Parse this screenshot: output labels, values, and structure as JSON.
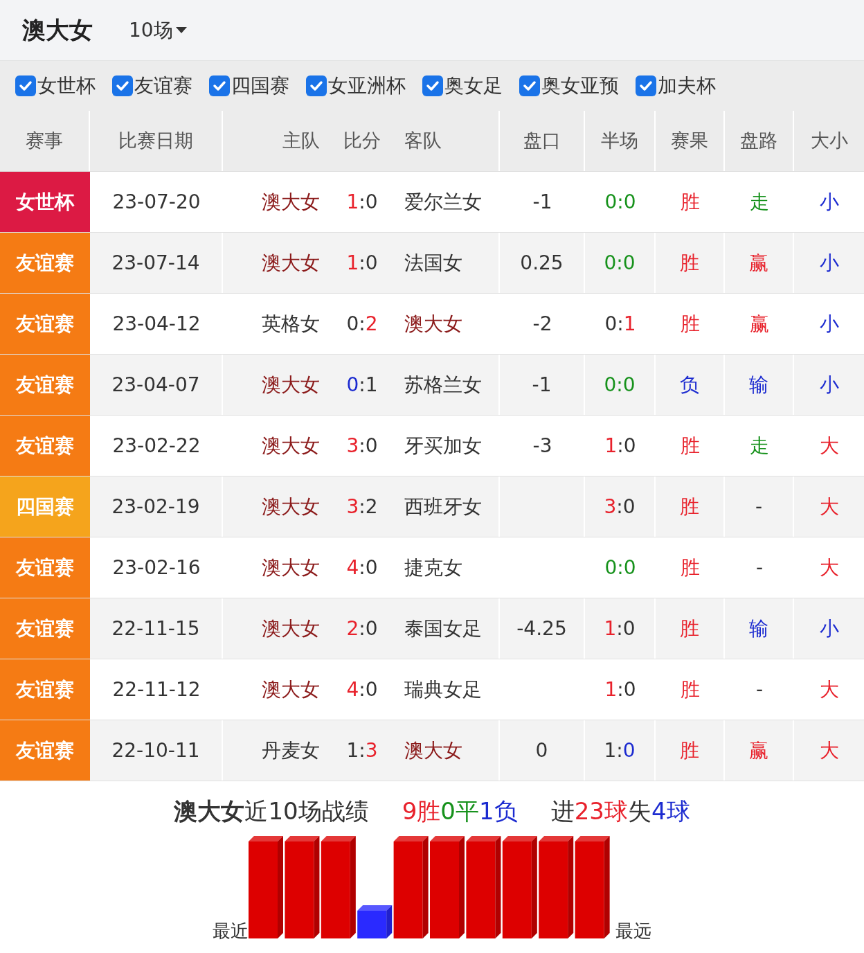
{
  "header": {
    "team": "澳大女",
    "match_count": "10场"
  },
  "filters": [
    {
      "label": "女世杯",
      "checked": true
    },
    {
      "label": "友谊赛",
      "checked": true
    },
    {
      "label": "四国赛",
      "checked": true
    },
    {
      "label": "女亚洲杯",
      "checked": true
    },
    {
      "label": "奥女足",
      "checked": true
    },
    {
      "label": "奥女亚预",
      "checked": true
    },
    {
      "label": "加夫杯",
      "checked": true
    }
  ],
  "table": {
    "columns": [
      "赛事",
      "比赛日期",
      "主队",
      "比分",
      "客队",
      "盘口",
      "半场",
      "赛果",
      "盘路",
      "大小"
    ],
    "rows": [
      {
        "competition": {
          "text": "女世杯",
          "color": "#dc1a44"
        },
        "date": "23-07-20",
        "home": {
          "name": "澳大女",
          "focus": true
        },
        "score": [
          {
            "text": "1",
            "color": "#e8212b"
          },
          {
            "text": ":0",
            "color": "#333333"
          }
        ],
        "away": {
          "name": "爱尔兰女",
          "focus": false
        },
        "handicap": "-1",
        "half": [
          {
            "text": "0:0",
            "color": "#17921c"
          }
        ],
        "result": {
          "text": "胜",
          "color": "#e8212b"
        },
        "line": {
          "text": "走",
          "color": "#17921c"
        },
        "total": {
          "text": "小",
          "color": "#1c2bd0"
        }
      },
      {
        "competition": {
          "text": "友谊赛",
          "color": "#f57b14"
        },
        "date": "23-07-14",
        "home": {
          "name": "澳大女",
          "focus": true
        },
        "score": [
          {
            "text": "1",
            "color": "#e8212b"
          },
          {
            "text": ":0",
            "color": "#333333"
          }
        ],
        "away": {
          "name": "法国女",
          "focus": false
        },
        "handicap": "0.25",
        "half": [
          {
            "text": "0:0",
            "color": "#17921c"
          }
        ],
        "result": {
          "text": "胜",
          "color": "#e8212b"
        },
        "line": {
          "text": "赢",
          "color": "#e8212b"
        },
        "total": {
          "text": "小",
          "color": "#1c2bd0"
        }
      },
      {
        "competition": {
          "text": "友谊赛",
          "color": "#f57b14"
        },
        "date": "23-04-12",
        "home": {
          "name": "英格女",
          "focus": false
        },
        "score": [
          {
            "text": "0:",
            "color": "#333333"
          },
          {
            "text": "2",
            "color": "#e8212b"
          }
        ],
        "away": {
          "name": "澳大女",
          "focus": true
        },
        "handicap": "-2",
        "half": [
          {
            "text": "0:",
            "color": "#333333"
          },
          {
            "text": "1",
            "color": "#e8212b"
          }
        ],
        "result": {
          "text": "胜",
          "color": "#e8212b"
        },
        "line": {
          "text": "赢",
          "color": "#e8212b"
        },
        "total": {
          "text": "小",
          "color": "#1c2bd0"
        }
      },
      {
        "competition": {
          "text": "友谊赛",
          "color": "#f57b14"
        },
        "date": "23-04-07",
        "home": {
          "name": "澳大女",
          "focus": true
        },
        "score": [
          {
            "text": "0",
            "color": "#1c2bd0"
          },
          {
            "text": ":1",
            "color": "#333333"
          }
        ],
        "away": {
          "name": "苏格兰女",
          "focus": false
        },
        "handicap": "-1",
        "half": [
          {
            "text": "0:0",
            "color": "#17921c"
          }
        ],
        "result": {
          "text": "负",
          "color": "#1c2bd0"
        },
        "line": {
          "text": "输",
          "color": "#1c2bd0"
        },
        "total": {
          "text": "小",
          "color": "#1c2bd0"
        }
      },
      {
        "competition": {
          "text": "友谊赛",
          "color": "#f57b14"
        },
        "date": "23-02-22",
        "home": {
          "name": "澳大女",
          "focus": true
        },
        "score": [
          {
            "text": "3",
            "color": "#e8212b"
          },
          {
            "text": ":0",
            "color": "#333333"
          }
        ],
        "away": {
          "name": "牙买加女",
          "focus": false
        },
        "handicap": "-3",
        "half": [
          {
            "text": "1",
            "color": "#e8212b"
          },
          {
            "text": ":0",
            "color": "#333333"
          }
        ],
        "result": {
          "text": "胜",
          "color": "#e8212b"
        },
        "line": {
          "text": "走",
          "color": "#17921c"
        },
        "total": {
          "text": "大",
          "color": "#e8212b"
        }
      },
      {
        "competition": {
          "text": "四国赛",
          "color": "#f5a41c"
        },
        "date": "23-02-19",
        "home": {
          "name": "澳大女",
          "focus": true
        },
        "score": [
          {
            "text": "3",
            "color": "#e8212b"
          },
          {
            "text": ":2",
            "color": "#333333"
          }
        ],
        "away": {
          "name": "西班牙女",
          "focus": false
        },
        "half": [
          {
            "text": "3",
            "color": "#e8212b"
          },
          {
            "text": ":0",
            "color": "#333333"
          }
        ],
        "result": {
          "text": "胜",
          "color": "#e8212b"
        },
        "line": {
          "text": "-",
          "color": "#333333"
        },
        "total": {
          "text": "大",
          "color": "#e8212b"
        }
      },
      {
        "competition": {
          "text": "友谊赛",
          "color": "#f57b14"
        },
        "date": "23-02-16",
        "home": {
          "name": "澳大女",
          "focus": true
        },
        "score": [
          {
            "text": "4",
            "color": "#e8212b"
          },
          {
            "text": ":0",
            "color": "#333333"
          }
        ],
        "away": {
          "name": "捷克女",
          "focus": false
        },
        "half": [
          {
            "text": "0:0",
            "color": "#17921c"
          }
        ],
        "result": {
          "text": "胜",
          "color": "#e8212b"
        },
        "line": {
          "text": "-",
          "color": "#333333"
        },
        "total": {
          "text": "大",
          "color": "#e8212b"
        }
      },
      {
        "competition": {
          "text": "友谊赛",
          "color": "#f57b14"
        },
        "date": "22-11-15",
        "home": {
          "name": "澳大女",
          "focus": true
        },
        "score": [
          {
            "text": "2",
            "color": "#e8212b"
          },
          {
            "text": ":0",
            "color": "#333333"
          }
        ],
        "away": {
          "name": "泰国女足",
          "focus": false
        },
        "handicap": "-4.25",
        "half": [
          {
            "text": "1",
            "color": "#e8212b"
          },
          {
            "text": ":0",
            "color": "#333333"
          }
        ],
        "result": {
          "text": "胜",
          "color": "#e8212b"
        },
        "line": {
          "text": "输",
          "color": "#1c2bd0"
        },
        "total": {
          "text": "小",
          "color": "#1c2bd0"
        }
      },
      {
        "competition": {
          "text": "友谊赛",
          "color": "#f57b14"
        },
        "date": "22-11-12",
        "home": {
          "name": "澳大女",
          "focus": true
        },
        "score": [
          {
            "text": "4",
            "color": "#e8212b"
          },
          {
            "text": ":0",
            "color": "#333333"
          }
        ],
        "away": {
          "name": "瑞典女足",
          "focus": false
        },
        "half": [
          {
            "text": "1",
            "color": "#e8212b"
          },
          {
            "text": ":0",
            "color": "#333333"
          }
        ],
        "result": {
          "text": "胜",
          "color": "#e8212b"
        },
        "line": {
          "text": "-",
          "color": "#333333"
        },
        "total": {
          "text": "大",
          "color": "#e8212b"
        }
      },
      {
        "competition": {
          "text": "友谊赛",
          "color": "#f57b14"
        },
        "date": "22-10-11",
        "home": {
          "name": "丹麦女",
          "focus": false
        },
        "score": [
          {
            "text": "1:",
            "color": "#333333"
          },
          {
            "text": "3",
            "color": "#e8212b"
          }
        ],
        "away": {
          "name": "澳大女",
          "focus": true
        },
        "handicap": "0",
        "half": [
          {
            "text": "1:",
            "color": "#333333"
          },
          {
            "text": "0",
            "color": "#1c2bd0"
          }
        ],
        "result": {
          "text": "胜",
          "color": "#e8212b"
        },
        "line": {
          "text": "赢",
          "color": "#e8212b"
        },
        "total": {
          "text": "大",
          "color": "#e8212b"
        }
      }
    ]
  },
  "summary": {
    "title": "**澳大女**近10场战绩",
    "record": [
      {
        "text": "9胜",
        "color": "#e8212b"
      },
      {
        "text": "0平",
        "color": "#17921c"
      },
      {
        "text": "1负",
        "color": "#1c2bd0"
      }
    ],
    "goals": [
      {
        "text": "进",
        "color": "#333333"
      },
      {
        "text": "23球",
        "color": "#e8212b"
      },
      {
        "text": "失",
        "color": "#333333"
      },
      {
        "text": "4球",
        "color": "#1c2bd0"
      }
    ],
    "form": [
      {
        "kind": "win",
        "color": "#dd0000"
      },
      {
        "kind": "win",
        "color": "#dd0000"
      },
      {
        "kind": "win",
        "color": "#dd0000"
      },
      {
        "kind": "loss",
        "color": "#2a2aff"
      },
      {
        "kind": "win",
        "color": "#dd0000"
      },
      {
        "kind": "win",
        "color": "#dd0000"
      },
      {
        "kind": "win",
        "color": "#dd0000"
      },
      {
        "kind": "win",
        "color": "#dd0000"
      },
      {
        "kind": "win",
        "color": "#dd0000"
      },
      {
        "kind": "win",
        "color": "#dd0000"
      }
    ],
    "recent_label": "最近",
    "oldest_label": "最远"
  }
}
